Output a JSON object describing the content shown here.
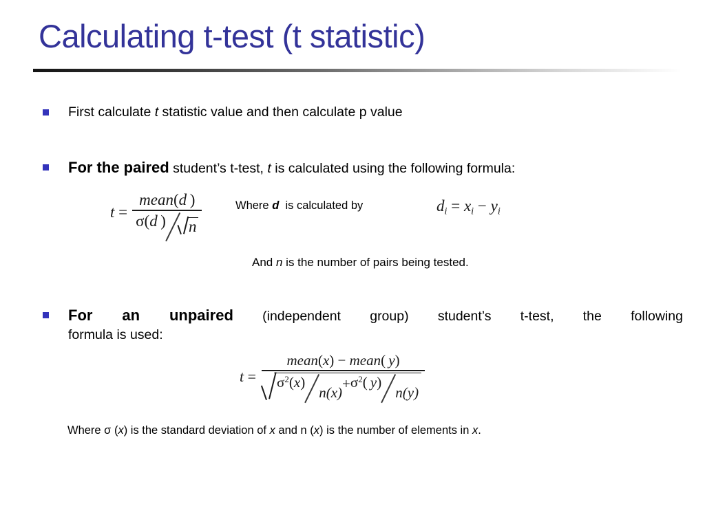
{
  "slide": {
    "title": "Calculating t-test (t statistic)",
    "title_color": "#333399",
    "bullet_color": "#3333bb",
    "background": "#ffffff"
  },
  "bullets": [
    {
      "id": "bullet-1",
      "lead": "",
      "text_before_italic": "First calculate ",
      "italic": "t",
      "text_after_italic": " statistic value and then calculate p value"
    },
    {
      "id": "bullet-2",
      "lead": "For the paired",
      "text_before_italic": " student’s t-test, ",
      "italic": "t",
      "text_after_italic": " is calculated using the following formula:"
    },
    {
      "id": "bullet-3",
      "lead": "For an unpaired",
      "line1_rest": " (independent group) student’s t-test, the following",
      "line2": "formula is used:"
    }
  ],
  "equations": {
    "paired": {
      "lhs": "t",
      "equals": "=",
      "numerator_fn": "mean",
      "numerator_arg": "(d)",
      "denominator_sigma": "σ",
      "denominator_sigma_arg": "(d)",
      "denominator_radicand": "n",
      "plain": "t = mean(d) / ( σ(d) / √n )"
    },
    "difference": {
      "lhs_var": "d",
      "lhs_sub": "i",
      "equals": "=",
      "term1_var": "x",
      "term1_sub": "i",
      "operator": "−",
      "term2_var": "y",
      "term2_sub": "i",
      "plain": "dᵢ = xᵢ − yᵢ"
    },
    "unpaired": {
      "lhs": "t",
      "equals": "=",
      "num_fn1": "mean",
      "num_arg1": "(x)",
      "num_operator": "−",
      "num_fn2": "mean",
      "num_arg2": "(y)",
      "den_sigma1": "σ",
      "den_sigma1_sup": "2",
      "den_sigma1_arg": "(x)",
      "den_n1": "n(x)",
      "den_plus": "+",
      "den_sigma2": "σ",
      "den_sigma2_sup": "2",
      "den_sigma2_arg": "(y)",
      "den_n2": "n(y)",
      "plain": "t = (mean(x) − mean(y)) / √( σ²(x)/n(x) + σ²(y)/n(y) )"
    }
  },
  "annotations": {
    "where_d_prefix": "Where ",
    "where_d_var": "d",
    "where_d_suffix": " is calculated by",
    "and_n_prefix": "And ",
    "and_n_var": "n",
    "and_n_suffix": " is the number of pairs being tested.",
    "footnote_p1": "Where σ (",
    "footnote_v1": "x",
    "footnote_p2": ") is the standard deviation of ",
    "footnote_v2": "x",
    "footnote_p3": " and n (",
    "footnote_v3": "x",
    "footnote_p4": ") is the number of elements in ",
    "footnote_v4": "x",
    "footnote_p5": "."
  }
}
